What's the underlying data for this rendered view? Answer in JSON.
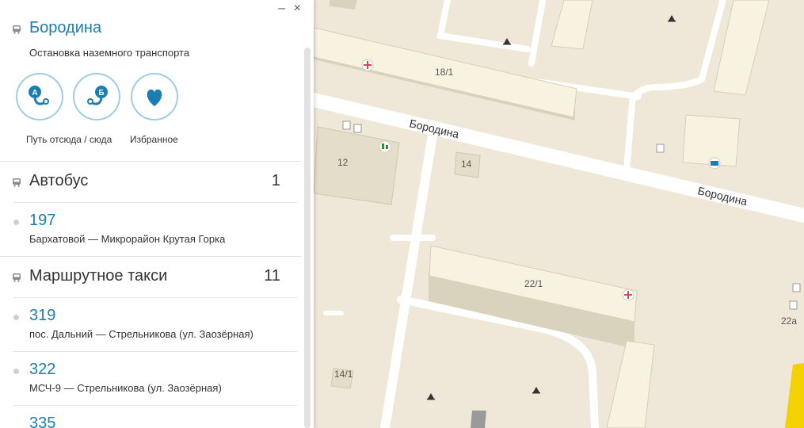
{
  "window": {
    "minimize_glyph": "–",
    "close_glyph": "×"
  },
  "stop": {
    "name": "Бородина",
    "subtitle": "Остановка наземного транспорта",
    "actions": [
      {
        "label": "Путь отсюда / сюда",
        "icons": [
          "route-from-icon",
          "route-to-icon"
        ]
      },
      {
        "label": "Избранное",
        "icon": "heart-icon"
      }
    ]
  },
  "sections": [
    {
      "title": "Автобус",
      "count": "1",
      "routes": [
        {
          "number": "197",
          "desc": "Бархатовой — Микрорайон Крутая Горка"
        }
      ]
    },
    {
      "title": "Маршрутное такси",
      "count": "11",
      "routes": [
        {
          "number": "319",
          "desc": "пос. Дальний — Стрельникова (ул. Заозёрная)"
        },
        {
          "number": "322",
          "desc": "МСЧ-9 — Стрельникова (ул. Заозёрная)"
        },
        {
          "number": "335",
          "desc": ""
        }
      ]
    }
  ],
  "map": {
    "street_labels": [
      "Бородина",
      "Бородина"
    ],
    "building_labels": [
      "18/1",
      "12",
      "14",
      "22/1",
      "14/1",
      "22а"
    ],
    "colors": {
      "background": "#efe8d8",
      "road": "#ffffff",
      "building_top": "#faf6e6",
      "accent": "#1a7db3"
    }
  }
}
